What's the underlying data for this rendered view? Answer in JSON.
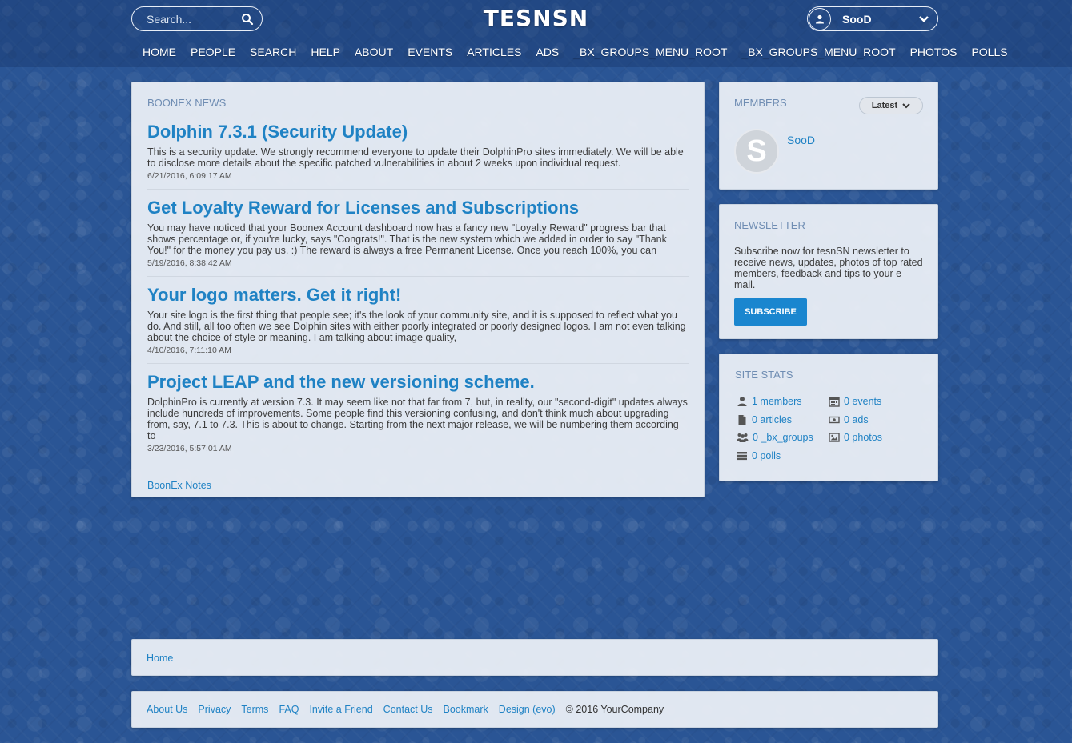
{
  "header": {
    "search_placeholder": "Search...",
    "logo": "TESNSN",
    "user_name": "SooD",
    "nav": [
      "HOME",
      "PEOPLE",
      "SEARCH",
      "HELP",
      "ABOUT",
      "EVENTS",
      "ARTICLES",
      "ADS",
      "_BX_GROUPS_MENU_ROOT",
      "_BX_GROUPS_MENU_ROOT",
      "PHOTOS",
      "POLLS"
    ]
  },
  "news": {
    "title": "BOONEX NEWS",
    "items": [
      {
        "title": "Dolphin 7.3.1 (Security Update)",
        "body": "This is a security update. We strongly recommend everyone to update their DolphinPro sites immediately. We will be able to disclose more details about the specific patched vulnerabilities in about 2 weeks upon individual request.",
        "date": "6/21/2016, 6:09:17 AM"
      },
      {
        "title": "Get Loyalty Reward for Licenses and Subscriptions",
        "body": "You may have noticed that your Boonex Account dashboard now has a fancy new \"Loyalty Reward\" progress bar that shows percentage or, if you're lucky, says \"Congrats!\". That is the new system which we added in order to say \"Thank You!\" for the money you pay us. :) The reward is always a free Permanent License. Once you reach 100%, you can",
        "date": "5/19/2016, 8:38:42 AM"
      },
      {
        "title": "Your logo matters. Get it right!",
        "body": "Your site logo is the first thing that people see; it's the look of your community site, and it is supposed to reflect what you do. And still, all too often we see Dolphin sites with either poorly integrated or poorly designed logos. I am not even talking about the choice of style or meaning. I am talking about image quality,",
        "date": "4/10/2016, 7:11:10 AM"
      },
      {
        "title": "Project LEAP and the new versioning scheme.",
        "body": "DolphinPro is currently at version 7.3. It may seem like not that far from 7, but, in reality, our \"second-digit\" updates always include hundreds of improvements. Some people find this versioning confusing, and don't think much about upgrading from, say, 7.1 to 7.3. This is about to change. Starting from the next major release, we will be numbering them according to",
        "date": "3/23/2016, 5:57:01 AM"
      }
    ],
    "link": "BoonEx Notes"
  },
  "members": {
    "title": "MEMBERS",
    "filter": "Latest",
    "avatar_letter": "S",
    "member_name": "SooD"
  },
  "newsletter": {
    "title": "NEWSLETTER",
    "text": "Subscribe now for tesnSN newsletter to receive news, updates, photos of top rated members, feedback and tips to your e-mail.",
    "button": "SUBSCRIBE"
  },
  "stats": {
    "title": "SITE STATS",
    "items": [
      {
        "icon": "user-icon",
        "label": "1 members"
      },
      {
        "icon": "calendar-icon",
        "label": "0 events"
      },
      {
        "icon": "file-icon",
        "label": "0 articles"
      },
      {
        "icon": "money-icon",
        "label": "0 ads"
      },
      {
        "icon": "group-icon",
        "label": "0 _bx_groups"
      },
      {
        "icon": "image-icon",
        "label": "0 photos"
      },
      {
        "icon": "tasks-icon",
        "label": "0 polls"
      }
    ]
  },
  "breadcrumb": {
    "home": "Home"
  },
  "footer": {
    "links": [
      "About Us",
      "Privacy",
      "Terms",
      "FAQ",
      "Invite a Friend",
      "Contact Us",
      "Bookmark",
      "Design (evo)"
    ],
    "copyright": "© 2016 YourCompany"
  }
}
